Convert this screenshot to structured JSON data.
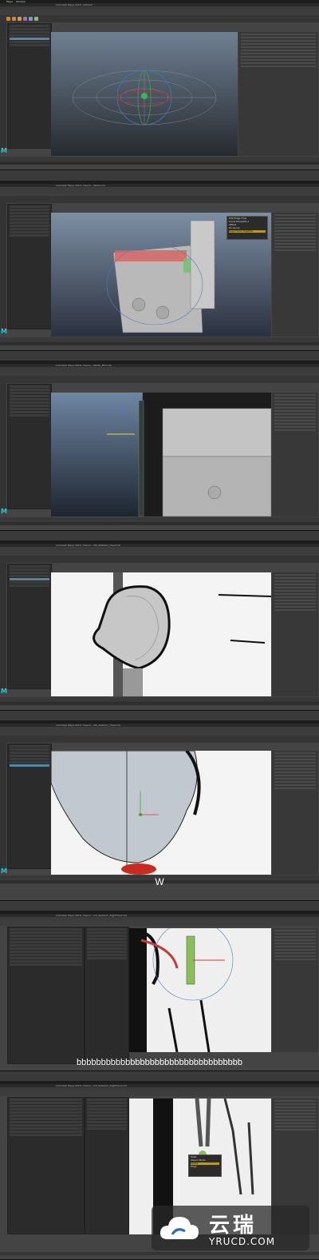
{
  "app": {
    "name": "Maya",
    "menu": "Window"
  },
  "frames": [
    {
      "title": "Autodesk Maya 2016: untitled*",
      "outliner_selected": "pSphere1",
      "panel_title": "polySphere1",
      "viewport_label": "persp",
      "layers": [
        "Display",
        "Anim"
      ]
    },
    {
      "title": "Autodesk Maya 2016: /Users/.../Radio.mb",
      "marking_menu": [
        "Edit Edge Flow",
        "Local Translate X",
        "Offset",
        "Divisions",
        "Keep Faces Together"
      ],
      "marking_highlight": "Keep Faces Together"
    },
    {
      "title": "Autodesk Maya 2016: /Users/.../Radio_Mod.mb"
    },
    {
      "title": "Autodesk Maya 2016: /Users/.../09_Skeleton_Head.mb"
    },
    {
      "title": "Autodesk Maya 2016: /Users/.../09_Skeleton_Head.mb",
      "caption": "W"
    },
    {
      "title": "Autodesk Maya 2016: /Users/.../10_Skeleton_RightHand.mb",
      "caption": "bbbbbbbbbbbbbbbbbbbbbbbbbbbbbbbbbb"
    },
    {
      "title": "Autodesk Maya 2016: /Users/.../10_Skeleton_RightHand.mb",
      "marking_menu": [
        "Multi",
        "Object Mode",
        "Vertex",
        "Edge",
        "Face",
        "UV"
      ]
    }
  ],
  "watermark": {
    "cn": "云瑞",
    "en": "YRUCD.COM"
  }
}
